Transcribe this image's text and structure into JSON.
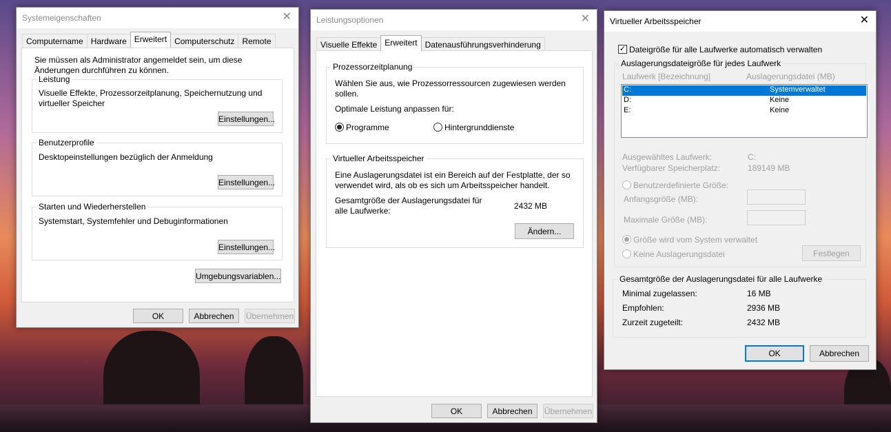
{
  "w1": {
    "title": "Systemeigenschaften",
    "tabs": [
      "Computername",
      "Hardware",
      "Erweitert",
      "Computerschutz",
      "Remote"
    ],
    "admin_note": "Sie müssen als Administrator angemeldet sein, um diese Änderungen durchführen zu können.",
    "leistung": {
      "label": "Leistung",
      "desc": "Visuelle Effekte, Prozessorzeitplanung, Speichernutzung und virtueller Speicher",
      "button": "Einstellungen..."
    },
    "benutzerprofile": {
      "label": "Benutzerprofile",
      "desc": "Desktopeinstellungen bezüglich der Anmeldung",
      "button": "Einstellungen..."
    },
    "starten": {
      "label": "Starten und Wiederherstellen",
      "desc": "Systemstart, Systemfehler und Debuginformationen",
      "button": "Einstellungen..."
    },
    "env_button": "Umgebungsvariablen...",
    "ok": "OK",
    "cancel": "Abbrechen",
    "apply": "Übernehmen"
  },
  "w2": {
    "title": "Leistungsoptionen",
    "tabs": [
      "Visuelle Effekte",
      "Erweitert",
      "Datenausführungsverhinderung"
    ],
    "cpu": {
      "label": "Prozessorzeitplanung",
      "desc": "Wählen Sie aus, wie Prozessorressourcen zugewiesen werden sollen.",
      "optimize": "Optimale Leistung anpassen für:",
      "opt1": "Programme",
      "opt2": "Hintergrunddienste"
    },
    "vm": {
      "label": "Virtueller Arbeitsspeicher",
      "desc": "Eine Auslagerungsdatei ist ein Bereich auf der Festplatte, der so verwendet wird, als ob es sich um Arbeitsspeicher handelt.",
      "total_label": "Gesamtgröße der Auslagerungsdatei für alle Laufwerke:",
      "total_value": "2432 MB",
      "change_button": "Ändern..."
    },
    "ok": "OK",
    "cancel": "Abbrechen",
    "apply": "Übernehmen"
  },
  "w3": {
    "title": "Virtueller Arbeitsspeicher",
    "auto_checkbox": "Dateigröße für alle Laufwerke automatisch verwalten",
    "group_label": "Auslagerungsdateigröße für jedes Laufwerk",
    "col_drive": "Laufwerk [Bezeichnung]",
    "col_file": "Auslagerungsdatei (MB)",
    "drives": [
      {
        "drive": "C:",
        "file": "Systemverwaltet"
      },
      {
        "drive": "D:",
        "file": "Keine"
      },
      {
        "drive": "E:",
        "file": "Keine"
      }
    ],
    "selected_label": "Ausgewähltes Laufwerk:",
    "selected_value": "C:",
    "free_label": "Verfügbarer Speicherplatz:",
    "free_value": "189149 MB",
    "custom_size": "Benutzerdefinierte Größe:",
    "initial_size": "Anfangsgröße (MB):",
    "max_size": "Maximale Größe (MB):",
    "system_managed": "Größe wird vom System verwaltet",
    "no_paging": "Keine Auslagerungsdatei",
    "set_button": "Festlegen",
    "total_group": "Gesamtgröße der Auslagerungsdatei für alle Laufwerke",
    "min_label": "Minimal zugelassen:",
    "min_value": "16 MB",
    "rec_label": "Empfohlen:",
    "rec_value": "2936 MB",
    "cur_label": "Zurzeit zugeteilt:",
    "cur_value": "2432 MB",
    "ok": "OK",
    "cancel": "Abbrechen"
  }
}
